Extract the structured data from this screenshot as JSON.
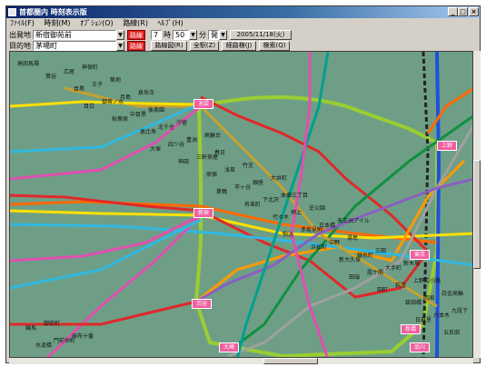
{
  "window": {
    "title": "首都圏内 時刻表示版"
  },
  "menu": [
    {
      "label": "ﾌｧｲﾙ(F)"
    },
    {
      "label": "時刻(M)"
    },
    {
      "label": "ｵﾌﾟｼｮﾝ(O)"
    },
    {
      "label": "路線(R)"
    },
    {
      "label": "ﾍﾙﾌﾟ(H)"
    }
  ],
  "search": {
    "from_label": "出発地",
    "from_value": "新宿御苑前",
    "to_label": "目的地",
    "to_value": "茅場町",
    "red_btn": "路線図",
    "hour": "7",
    "hour_unit": "時",
    "minute": "50",
    "minute_unit": "分",
    "mode": "発",
    "date": "2005/11/18(火)",
    "btn_route": "路線図(R)",
    "btn_all": "全駅(Z)",
    "btn_result": "経路検(J)",
    "btn_cancel": "検索(Q)"
  },
  "map": {
    "hubs": [
      "池袋",
      "新宿",
      "渋谷",
      "品川",
      "上野",
      "東京",
      "新橋",
      "大崎"
    ],
    "stations": [
      "高田馬場",
      "目白",
      "大塚",
      "巣鴨",
      "駒込",
      "田端",
      "日暮里",
      "鶯谷",
      "秋葉原",
      "神田",
      "有楽町",
      "浜松町",
      "田町",
      "五反田",
      "目黒",
      "恵比寿",
      "原宿",
      "代々木",
      "新大久保",
      "飯田橋",
      "水道橋",
      "御茶ノ水",
      "四ツ谷",
      "市ヶ谷",
      "赤坂見附",
      "霞ケ関",
      "六本木",
      "広尾",
      "中目黒",
      "三軒茶屋",
      "下北沢",
      "中野",
      "荻窪",
      "練馬",
      "王子",
      "北千住",
      "浅草",
      "押上",
      "錦糸町",
      "両国",
      "門前仲町",
      "月島",
      "豊洲",
      "銀座",
      "日本橋",
      "大手町",
      "九段下",
      "神保町",
      "後楽園",
      "春日",
      "本郷三丁目",
      "湯島",
      "上野広小路",
      "御徒町",
      "築地",
      "汐留",
      "竹芝",
      "芝公園",
      "三田",
      "白金高輪",
      "麻布十番",
      "泉岳寺",
      "高輪台",
      "大井町",
      "天王洲アイル",
      "新木場"
    ]
  },
  "colors": {
    "map_bg": "#6e9f86",
    "yamanote": "#9acd32",
    "chuo": "#ff6a00",
    "sobu": "#ffe000",
    "keihin": "#1e50e0",
    "marunouchi": "#e02828",
    "hibiya": "#a0a0a0",
    "ginza": "#ff9a00",
    "tozai": "#30b8e0",
    "chiyoda": "#109040",
    "yurakucho": "#c8a030",
    "hanzomon": "#8a5fc0",
    "namboku": "#00a090",
    "toei": "#e050b0",
    "hub": "#f060a0"
  }
}
